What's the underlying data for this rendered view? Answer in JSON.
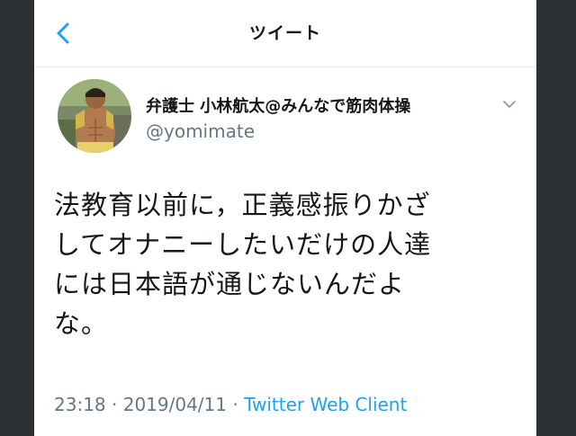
{
  "header": {
    "title": "ツイート"
  },
  "tweet": {
    "display_name": "弁護士 小林航太@みんなで筋肉体操",
    "handle": "@yomimate",
    "text": "法教育以前に，正義感振りかざ\nしてオナニーしたいだけの人達\nには日本語が通じないんだよ\nな。",
    "time": "23:18",
    "separator": "·",
    "date": "2019/04/11",
    "client": "Twitter Web Client"
  },
  "colors": {
    "accent": "#1da1f2",
    "secondary_text": "#657786",
    "primary_text": "#14171a"
  },
  "icons": {
    "back": "chevron-left-icon",
    "caret": "chevron-down-icon"
  }
}
